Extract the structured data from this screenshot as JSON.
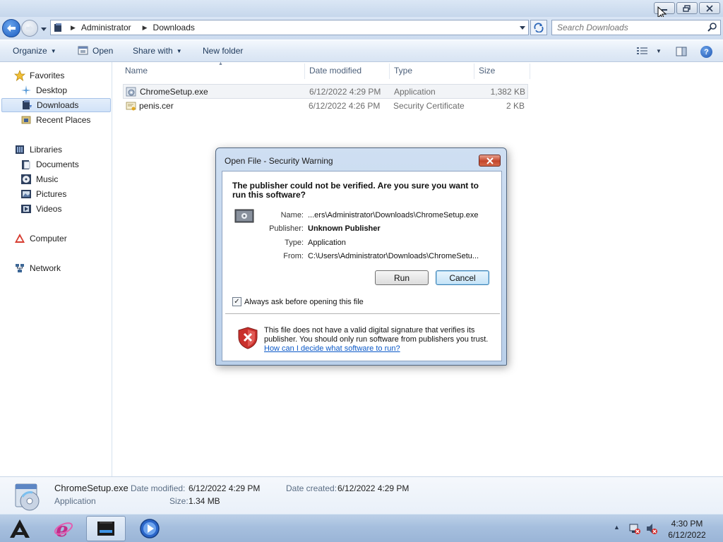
{
  "window": {
    "caption_buttons": [
      "minimize",
      "maximize",
      "close"
    ]
  },
  "address": {
    "crumbs": [
      "Administrator",
      "Downloads"
    ],
    "search_placeholder": "Search Downloads"
  },
  "toolbar": {
    "organize": "Organize",
    "open": "Open",
    "share_with": "Share with",
    "new_folder": "New folder"
  },
  "nav": {
    "favorites": "Favorites",
    "desktop": "Desktop",
    "downloads": "Downloads",
    "recent_places": "Recent Places",
    "libraries": "Libraries",
    "documents": "Documents",
    "music": "Music",
    "pictures": "Pictures",
    "videos": "Videos",
    "computer": "Computer",
    "network": "Network"
  },
  "columns": {
    "name": "Name",
    "date_modified": "Date modified",
    "type": "Type",
    "size": "Size"
  },
  "files": [
    {
      "name": "ChromeSetup.exe",
      "date": "6/12/2022 4:29 PM",
      "type": "Application",
      "size": "1,382 KB",
      "selected": true
    },
    {
      "name": "penis.cer",
      "date": "6/12/2022 4:26 PM",
      "type": "Security Certificate",
      "size": "2 KB",
      "selected": false
    }
  ],
  "details": {
    "filename": "ChromeSetup.exe",
    "filetype": "Application",
    "modified_label": "Date modified:",
    "modified_value": "6/12/2022 4:29 PM",
    "created_label": "Date created:",
    "created_value": "6/12/2022 4:29 PM",
    "size_label": "Size:",
    "size_value": "1.34 MB"
  },
  "dialog": {
    "title": "Open File - Security Warning",
    "question": "The publisher could not be verified.  Are you sure you want to run this software?",
    "name_label": "Name:",
    "name_value": "...ers\\Administrator\\Downloads\\ChromeSetup.exe",
    "publisher_label": "Publisher:",
    "publisher_value": "Unknown Publisher",
    "type_label": "Type:",
    "type_value": "Application",
    "from_label": "From:",
    "from_value": "C:\\Users\\Administrator\\Downloads\\ChromeSetu...",
    "run": "Run",
    "cancel": "Cancel",
    "always_ask": "Always ask before opening this file",
    "always_ask_checked": true,
    "warning": "This file does not have a valid digital signature that verifies its publisher.  You should only run software from publishers you trust.",
    "link": "How can I decide what software to run?"
  },
  "taskbar": {
    "time": "4:30 PM",
    "date": "6/12/2022"
  }
}
